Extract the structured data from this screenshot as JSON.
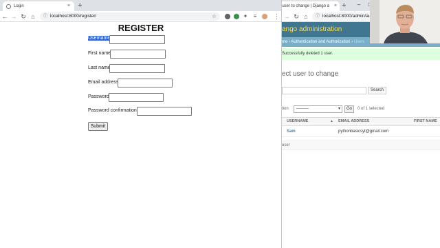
{
  "left_browser": {
    "tab": {
      "title": "Login",
      "close": "×"
    },
    "new_tab": "+",
    "url": "localhost:8000/register/",
    "page": {
      "title": "REGISTER",
      "fields": [
        {
          "label": "Username",
          "value": ""
        },
        {
          "label": "First name",
          "value": ""
        },
        {
          "label": "Last name",
          "value": ""
        },
        {
          "label": "Email address",
          "value": ""
        },
        {
          "label": "Password",
          "value": ""
        },
        {
          "label": "Password confirmation",
          "value": ""
        }
      ],
      "submit_label": "Submit"
    }
  },
  "right_browser": {
    "tab": {
      "title": "ct user to change | Django a",
      "close": "×"
    },
    "new_tab": "+",
    "url": "localhost:8000/admin/auth/u",
    "window_controls": {
      "minimize": "–",
      "maximize": "□"
    },
    "header": "ango administration",
    "breadcrumbs": {
      "home": "me",
      "sep1": " › ",
      "section": "Authentication and Authorization",
      "sep2": " › ",
      "current": "Users"
    },
    "message": "Successfully deleted 1 user.",
    "heading": "ect user to change",
    "search_button": "Search",
    "action_label": "tion",
    "action_select": "---------",
    "go_button": "Go",
    "selected_count": "0 of 1 selected",
    "columns": {
      "username": "USERNAME",
      "sort": "▲",
      "email": "EMAIL ADDRESS",
      "first_name": "FIRST NAME"
    },
    "rows": [
      {
        "username": "Sam",
        "email": "pythonbasicsyt@gmail.com"
      }
    ],
    "footer": "user"
  },
  "colors": {
    "django_header": "#417690",
    "django_breadcrumb": "#79aec8",
    "django_brand": "#f5dd5d",
    "message_bg": "#ddffdd",
    "selection": "#3367d6"
  },
  "icons": [
    "globe-icon",
    "close-icon",
    "plus-icon",
    "back-arrow-icon",
    "forward-arrow-icon",
    "reload-icon",
    "home-icon",
    "info-icon",
    "star-icon",
    "puzzle-icon",
    "menu-dots-icon"
  ]
}
